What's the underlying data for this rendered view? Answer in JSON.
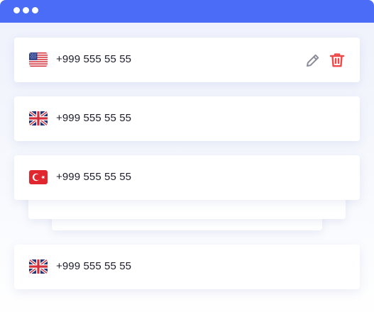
{
  "window": {
    "accent_color": "#4a6cf7",
    "control_dots": [
      "dot",
      "dot",
      "dot"
    ]
  },
  "contacts": [
    {
      "flag": "us-flag-icon",
      "phone": "+999 555 55 55",
      "actions": [
        "edit-icon",
        "trash-icon"
      ]
    },
    {
      "flag": "uk-flag-icon",
      "phone": "+999 555 55 55"
    },
    {
      "flag": "turkey-flag-icon",
      "phone": "+999 555 55 55"
    },
    {
      "flag": "uk-flag-icon",
      "phone": "+999 555 55 55"
    }
  ],
  "colors": {
    "delete_red": "#f04848",
    "edit_gray": "#8a8d99",
    "text": "#1d1d2b"
  }
}
